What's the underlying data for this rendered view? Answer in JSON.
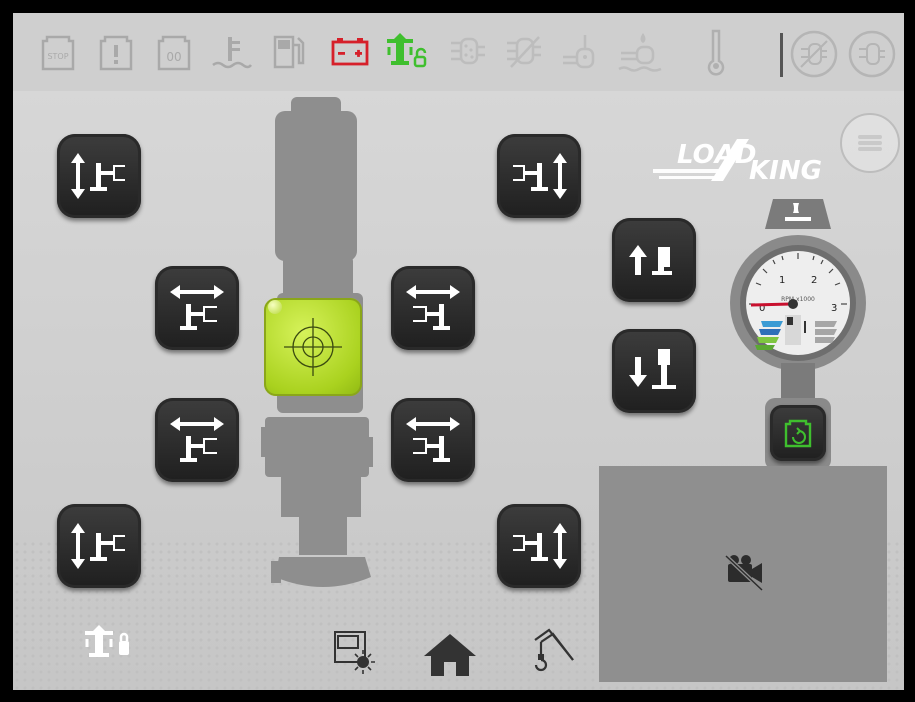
{
  "top_bar": {
    "icons": [
      {
        "name": "stop-engine-icon",
        "label": "STOP",
        "state": "inactive"
      },
      {
        "name": "warning-engine-icon",
        "label": "!",
        "state": "inactive"
      },
      {
        "name": "glow-plug-engine-icon",
        "label": "00",
        "state": "inactive"
      },
      {
        "name": "coolant-level-icon",
        "state": "inactive"
      },
      {
        "name": "fuel-icon",
        "state": "inactive"
      },
      {
        "name": "battery-icon",
        "state": "active-red"
      },
      {
        "name": "outrigger-unlocked-icon",
        "state": "active-green"
      },
      {
        "name": "dpf-icon",
        "state": "inactive"
      },
      {
        "name": "dpf-inhibit-icon",
        "state": "inactive"
      },
      {
        "name": "exhaust-temp-icon",
        "state": "inactive"
      },
      {
        "name": "def-level-icon",
        "state": "inactive"
      },
      {
        "name": "temperature-icon",
        "state": "inactive"
      },
      {
        "name": "regen-inhibit-icon",
        "state": "inactive"
      },
      {
        "name": "regen-request-icon",
        "state": "inactive"
      }
    ],
    "stop_label": "STOP",
    "glow_label": "00"
  },
  "colors": {
    "battery_red": "#d6202a",
    "active_green": "#3fbf2e",
    "level_green": "#aad21f",
    "button_dark": "#2b2b2b",
    "inactive_icon": "#a9a9a9",
    "camera_bg": "#8f8f8f"
  },
  "outrigger_controls": [
    {
      "name": "front-left-jack-up-down-button",
      "icon": "jack-up-down-icon"
    },
    {
      "name": "front-right-jack-up-down-button",
      "icon": "jack-up-down-icon"
    },
    {
      "name": "mid-front-left-extend-button",
      "icon": "jack-extend-icon"
    },
    {
      "name": "mid-front-right-extend-button",
      "icon": "jack-extend-icon"
    },
    {
      "name": "mid-rear-left-extend-button",
      "icon": "jack-extend-icon"
    },
    {
      "name": "mid-rear-right-extend-button",
      "icon": "jack-extend-icon"
    },
    {
      "name": "rear-left-jack-up-down-button",
      "icon": "jack-up-down-icon"
    },
    {
      "name": "rear-right-jack-up-down-button",
      "icon": "jack-up-down-icon"
    },
    {
      "name": "all-jacks-up-button",
      "icon": "arrow-up-icon"
    },
    {
      "name": "all-jacks-down-button",
      "icon": "arrow-down-icon"
    }
  ],
  "logo": {
    "line1": "LOAD",
    "line2": "KING"
  },
  "gauge": {
    "label": "RPM x1000",
    "ticks": [
      "0",
      "1",
      "2",
      "3"
    ],
    "rpm_value": 0,
    "engine_start_icon": "engine-start-icon"
  },
  "camera": {
    "status_icon": "camera-off-icon"
  },
  "bottom_nav": {
    "items": [
      {
        "name": "outrigger-lock-icon"
      },
      {
        "name": "cab-light-icon"
      },
      {
        "name": "home-icon"
      },
      {
        "name": "crane-hook-icon"
      }
    ]
  }
}
